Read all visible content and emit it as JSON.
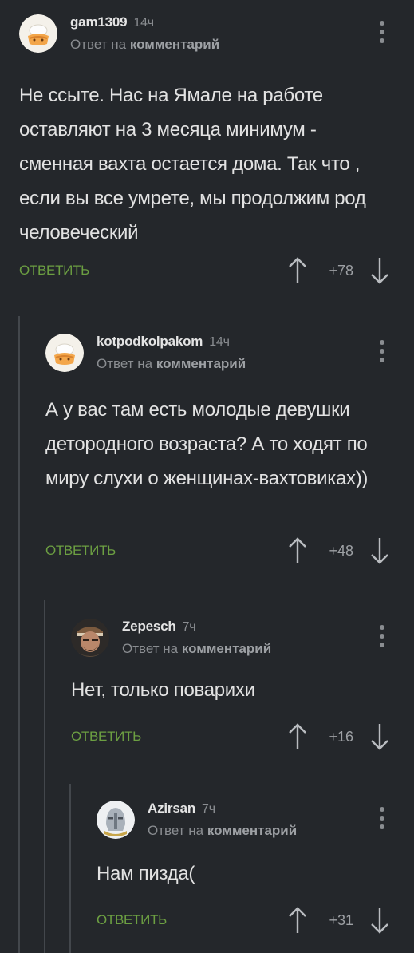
{
  "comments": [
    {
      "author": "gam1309",
      "time": "14ч",
      "reply_prefix": "Ответ на",
      "reply_target": "комментарий",
      "text": "Не ссыте. Нас на Ямале на работе оставляют на 3 месяца минимум - сменная вахта остается дома. Так что , если вы все умрете, мы продолжим род человеческий",
      "reply_label": "ОТВЕТИТЬ",
      "rating": "+78",
      "avatar_icon": "pie-avatar-icon"
    },
    {
      "author": "kotpodkolpakom",
      "time": "14ч",
      "reply_prefix": "Ответ на",
      "reply_target": "комментарий",
      "text": "А у вас там есть молодые девушки детородного возраста? А то ходят по миру слухи о женщинах-вахтовиках))",
      "reply_label": "ОТВЕТИТЬ",
      "rating": "+48",
      "avatar_icon": "pie-avatar-icon"
    },
    {
      "author": "Zepesch",
      "time": "7ч",
      "reply_prefix": "Ответ на",
      "reply_target": "комментарий",
      "text": "Нет, только поварихи",
      "reply_label": "ОТВЕТИТЬ",
      "rating": "+16",
      "avatar_icon": "bearded-man-avatar-icon"
    },
    {
      "author": "Azirsan",
      "time": "7ч",
      "reply_prefix": "Ответ на",
      "reply_target": "комментарий",
      "text": "Нам пизда(",
      "reply_label": "ОТВЕТИТЬ",
      "rating": "+31",
      "avatar_icon": "helmet-avatar-icon"
    }
  ],
  "colors": {
    "background": "#24272b",
    "accent": "#6c9f42",
    "thread_line": "#43474c"
  }
}
